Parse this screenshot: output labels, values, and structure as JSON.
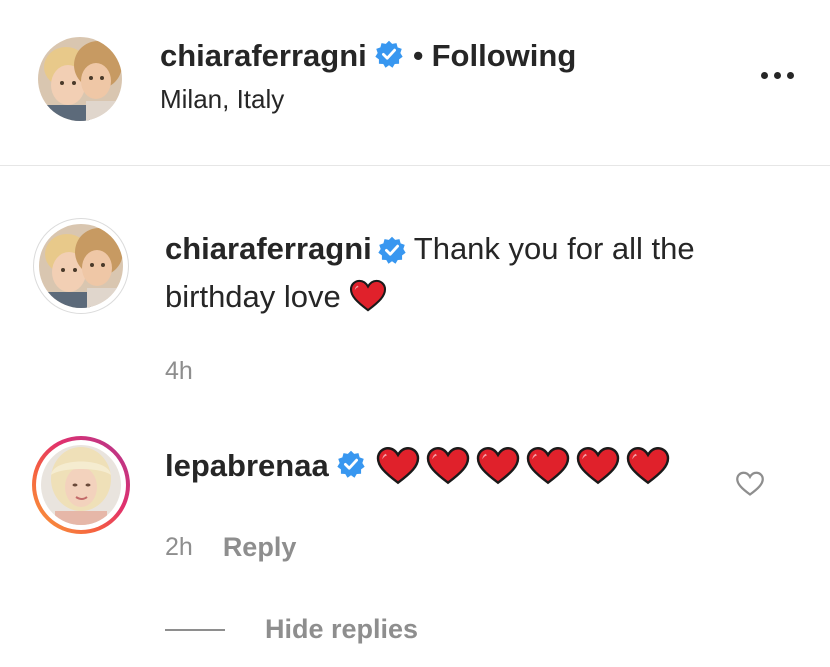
{
  "header": {
    "username": "chiaraferragni",
    "verified_icon": "verified-badge-icon",
    "separator": "•",
    "follow_status": "Following",
    "location": "Milan, Italy",
    "more_icon": "more-options-icon"
  },
  "caption": {
    "username": "chiaraferragni",
    "verified_icon": "verified-badge-icon",
    "text": "Thank you for all the birthday love",
    "emoji": "red-heart-icon",
    "time": "4h"
  },
  "reply": {
    "username": "lepabrenaa",
    "verified_icon": "verified-badge-icon",
    "hearts_count": 6,
    "time": "2h",
    "reply_label": "Reply",
    "like_icon": "heart-outline-icon"
  },
  "hide_replies_label": "Hide replies",
  "colors": {
    "verified_blue": "#3897f0",
    "heart_red": "#e0212b",
    "text_primary": "#262626",
    "text_secondary": "#8e8e8e",
    "divider": "#e6e6e6"
  }
}
